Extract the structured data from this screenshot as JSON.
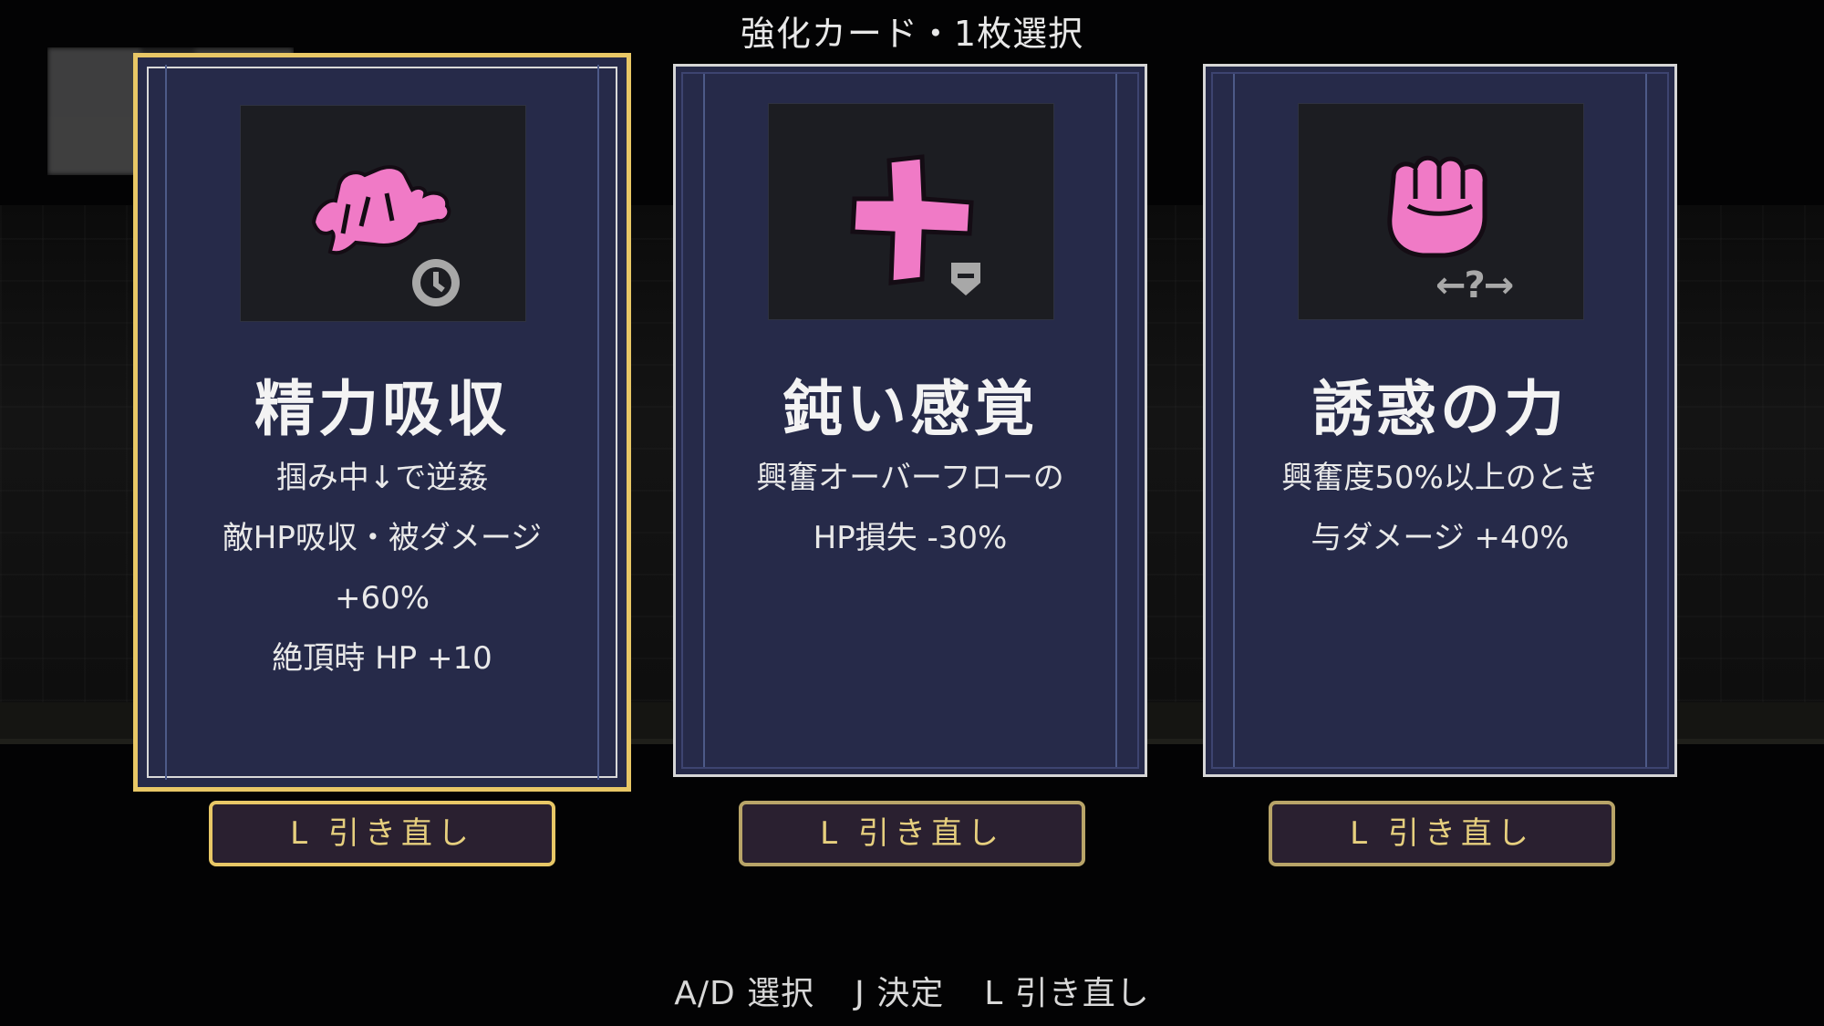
{
  "header": {
    "title": "強化カード・1枚選択"
  },
  "cards": [
    {
      "name": "精力吸収",
      "icon": "grab-hand-icon",
      "badge_icon": "clock-icon",
      "description": [
        "掴み中↓で逆姦",
        "敵HP吸収・被ダメージ",
        "+60%",
        "絶頂時 HP +10"
      ],
      "selected": true
    },
    {
      "name": "鈍い感覚",
      "icon": "plus-icon",
      "badge_icon": "shield-down-icon",
      "description": [
        "興奮オーバーフローの",
        "HP損失 -30%"
      ],
      "selected": false
    },
    {
      "name": "誘惑の力",
      "icon": "fist-icon",
      "badge_icon": "random-swap-icon",
      "badge_text": "←?→",
      "description": [
        "興奮度50%以上のとき",
        "与ダメージ +40%"
      ],
      "selected": false
    }
  ],
  "redraw_button": {
    "label": "L  引き直し"
  },
  "footer": {
    "select": "A/D 選択",
    "confirm": "J 決定",
    "redraw": "L 引き直し"
  },
  "colors": {
    "card_bg": "#262a49",
    "selected_border": "#e8c766",
    "icon_pink": "#f07ac6",
    "button_text": "#e6cf7e"
  }
}
